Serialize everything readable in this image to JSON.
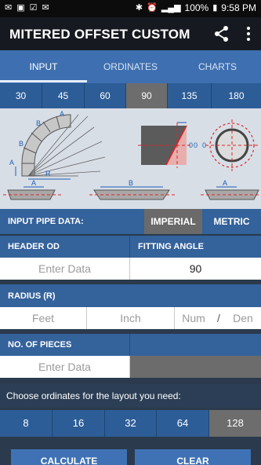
{
  "status_bar": {
    "left_icons": [
      "sms-icon",
      "image-icon",
      "tasks-icon",
      "email-icon"
    ],
    "battery": "100%",
    "time": "9:58 PM"
  },
  "app_bar": {
    "title": "MITERED OFFSET CUSTOM"
  },
  "tabs": [
    {
      "label": "INPUT",
      "active": true
    },
    {
      "label": "ORDINATES",
      "active": false
    },
    {
      "label": "CHARTS",
      "active": false
    }
  ],
  "angles": [
    {
      "label": "30",
      "selected": false
    },
    {
      "label": "45",
      "selected": false
    },
    {
      "label": "60",
      "selected": false
    },
    {
      "label": "90",
      "selected": true
    },
    {
      "label": "135",
      "selected": false
    },
    {
      "label": "180",
      "selected": false
    }
  ],
  "diagram": {
    "labels": {
      "a": "A",
      "b": "B",
      "r": "R",
      "zero": "0"
    }
  },
  "input_pipe": {
    "label": "INPUT PIPE DATA:",
    "imperial": "IMPERIAL",
    "metric": "METRIC",
    "selected": "IMPERIAL"
  },
  "header_od": {
    "label": "HEADER OD",
    "placeholder": "Enter Data"
  },
  "fitting_angle": {
    "label": "FITTING ANGLE",
    "value": "90"
  },
  "radius": {
    "label": "RADIUS (R)",
    "feet_placeholder": "Feet",
    "inch_placeholder": "Inch",
    "num_placeholder": "Num",
    "slash": "/",
    "den_placeholder": "Den"
  },
  "pieces": {
    "label": "NO. OF PIECES",
    "placeholder": "Enter Data"
  },
  "ordinates": {
    "prompt": "Choose ordinates for the layout you need:",
    "options": [
      {
        "label": "8",
        "selected": false
      },
      {
        "label": "16",
        "selected": false
      },
      {
        "label": "32",
        "selected": false
      },
      {
        "label": "64",
        "selected": false
      },
      {
        "label": "128",
        "selected": true
      }
    ]
  },
  "actions": {
    "calculate": "CALCULATE",
    "clear": "CLEAR"
  },
  "colors": {
    "tab_blue": "#3e6fb0",
    "button_blue": "#2d5d97",
    "selected_gray": "#6d6d6d",
    "diagram_red": "#e02424"
  }
}
